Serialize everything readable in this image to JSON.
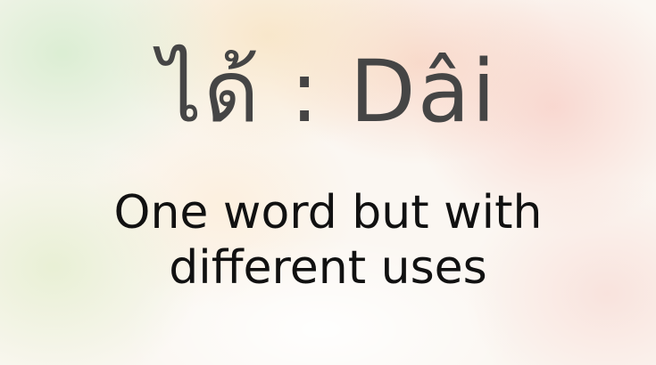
{
  "title": "ได้ : Dâi",
  "subtitle_line1": "One word but with",
  "subtitle_line2": "different uses",
  "colors": {
    "title_text": "#454545",
    "subtitle_text": "#111111",
    "background_green": "#d6ecce",
    "background_peach": "#f8e4c4",
    "background_pink": "#f8d0c8"
  }
}
